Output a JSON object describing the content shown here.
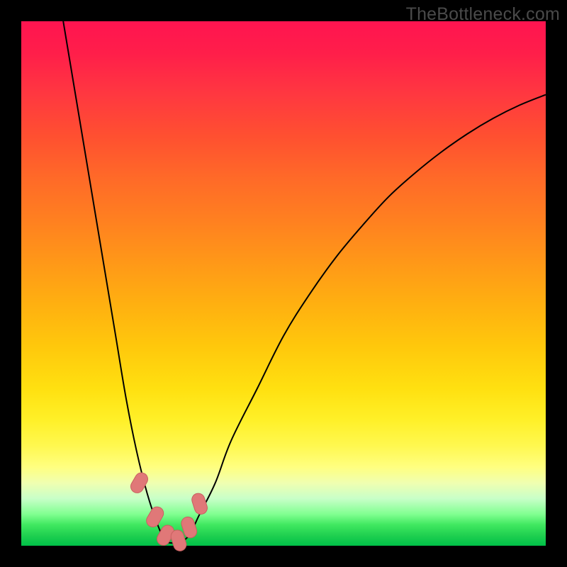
{
  "watermark": "TheBottleneck.com",
  "chart_data": {
    "type": "line",
    "title": "",
    "xlabel": "",
    "ylabel": "",
    "xlim": [
      0,
      100
    ],
    "ylim": [
      0,
      100
    ],
    "series": [
      {
        "name": "bottleneck-curve",
        "x": [
          8,
          10,
          12,
          14,
          16,
          18,
          20,
          22,
          24,
          26,
          27.5,
          29,
          30,
          32,
          34,
          37,
          40,
          45,
          50,
          55,
          60,
          65,
          70,
          75,
          80,
          85,
          90,
          95,
          100
        ],
        "values": [
          100,
          88,
          76,
          64,
          52,
          40,
          28,
          18,
          10,
          4,
          1,
          0.5,
          0.5,
          2,
          6,
          12,
          20,
          30,
          40,
          48,
          55,
          61,
          66.5,
          71,
          75,
          78.5,
          81.5,
          84,
          86
        ]
      }
    ],
    "markers": [
      {
        "x": 22.5,
        "y": 12
      },
      {
        "x": 25.5,
        "y": 5.5
      },
      {
        "x": 27.5,
        "y": 2
      },
      {
        "x": 30,
        "y": 1
      },
      {
        "x": 32,
        "y": 3.5
      },
      {
        "x": 34,
        "y": 8
      }
    ],
    "background_gradient": {
      "top": "#ff1450",
      "middle": "#ffd000",
      "bottom": "#00c048"
    }
  }
}
